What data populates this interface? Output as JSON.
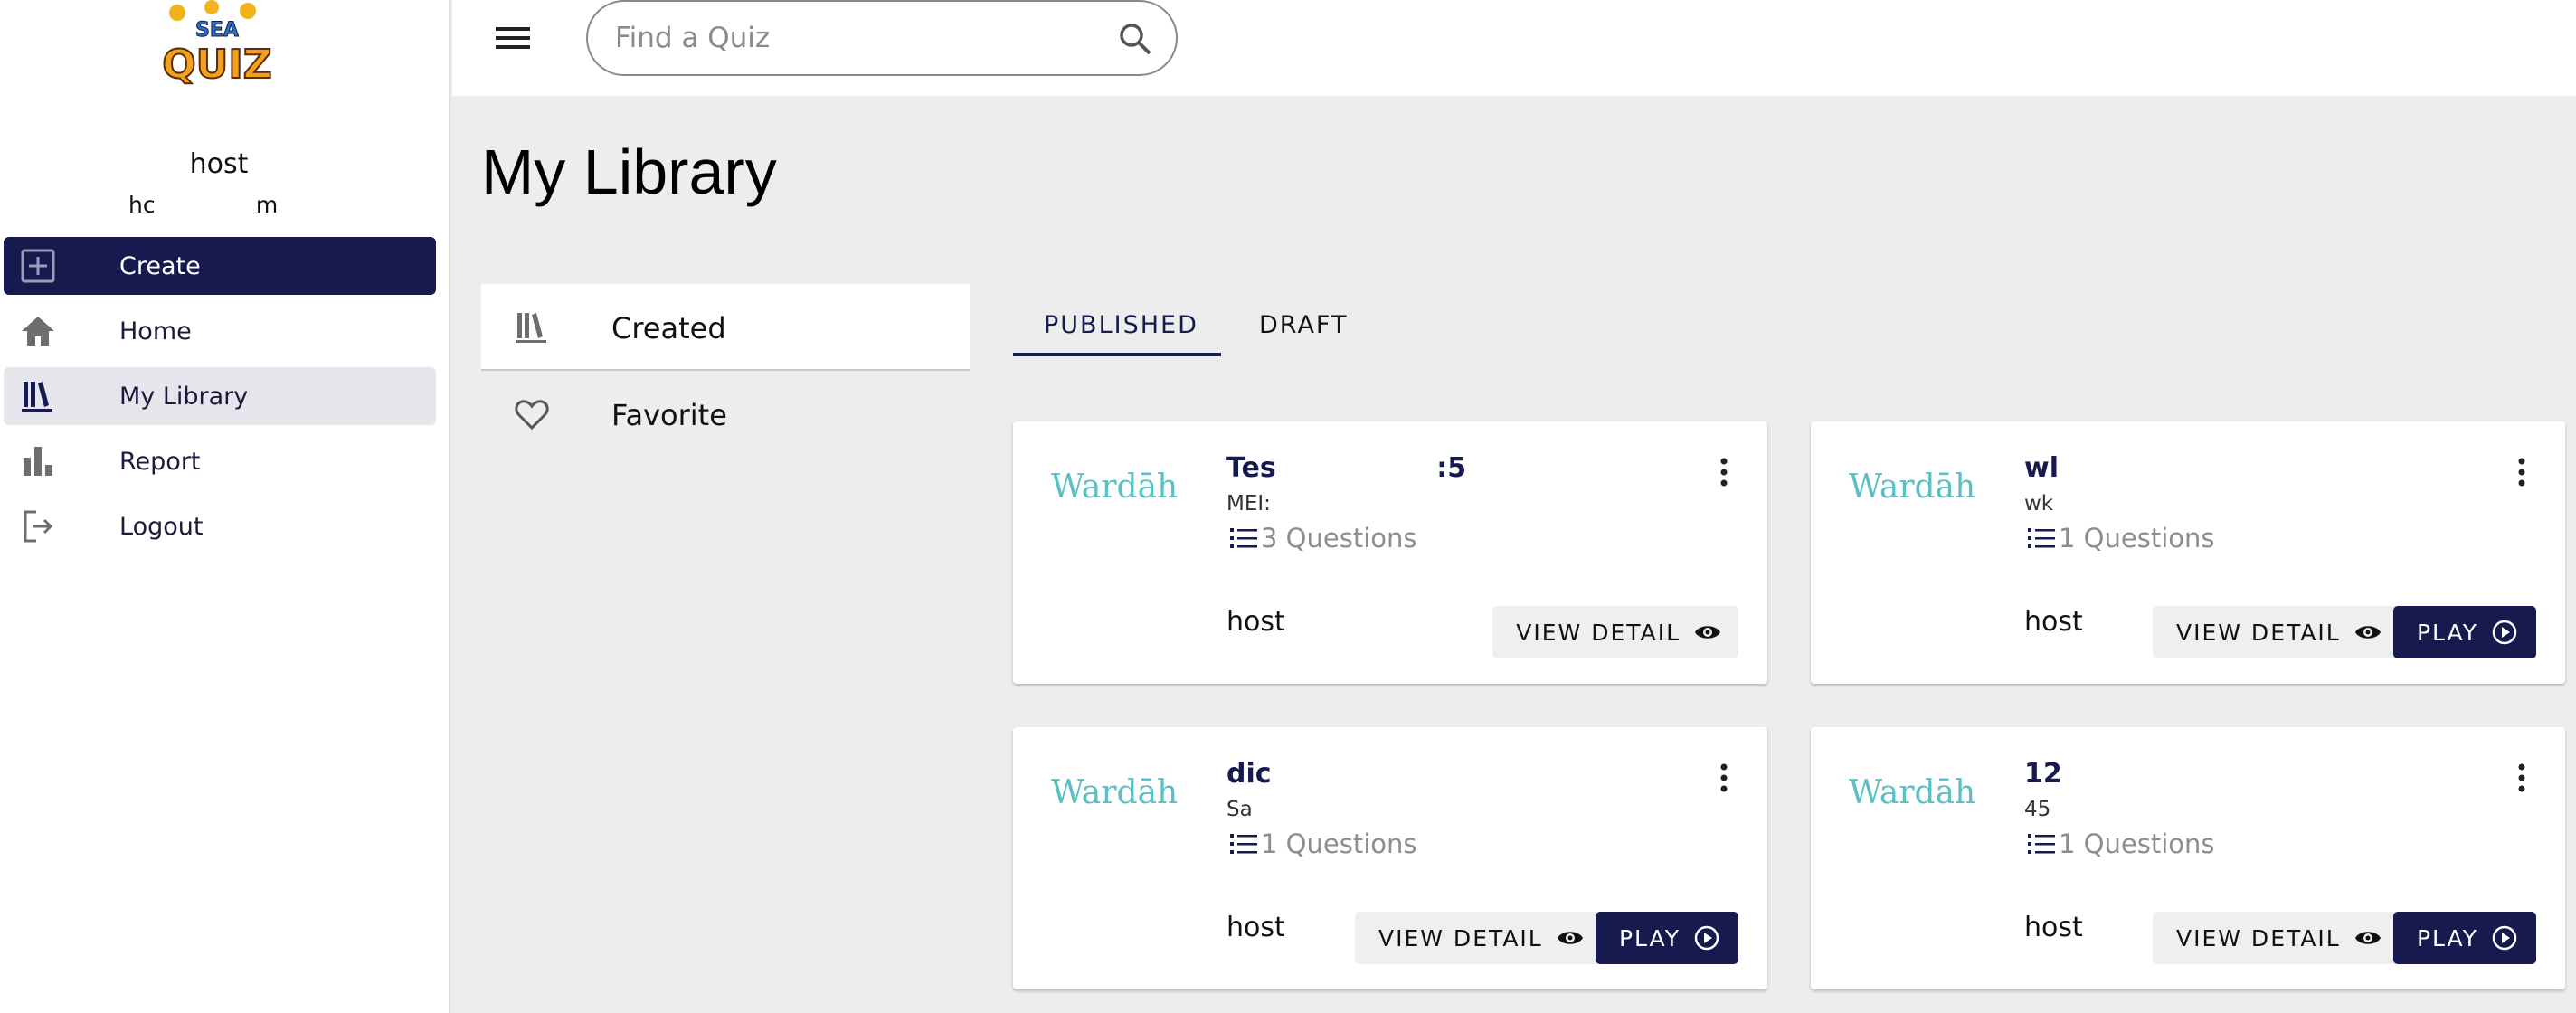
{
  "app": {
    "logo_text": "SEA QUIZ"
  },
  "sidebar": {
    "user_name": "host",
    "user_email": "hc              m",
    "items": [
      {
        "label": "Create",
        "icon": "add-box-icon"
      },
      {
        "label": "Home",
        "icon": "home-icon"
      },
      {
        "label": "My Library",
        "icon": "library-icon"
      },
      {
        "label": "Report",
        "icon": "bar-chart-icon"
      },
      {
        "label": "Logout",
        "icon": "logout-icon"
      }
    ]
  },
  "search": {
    "placeholder": "Find a Quiz",
    "value": ""
  },
  "page": {
    "title": "My Library"
  },
  "filters": [
    {
      "label": "Created",
      "icon": "library-icon"
    },
    {
      "label": "Favorite",
      "icon": "heart-icon"
    }
  ],
  "tabs": [
    {
      "label": "PUBLISHED"
    },
    {
      "label": "DRAFT"
    }
  ],
  "cards": [
    {
      "brand": "Wardāh",
      "title": "Tes                 :5",
      "subtitle": "MEI:",
      "questions": "3 Questions",
      "author": "host",
      "view_label": "VIEW DETAIL",
      "play_label": ""
    },
    {
      "brand": "Wardāh",
      "title": "wl",
      "subtitle": "wk",
      "questions": "1 Questions",
      "author": "host",
      "view_label": "VIEW DETAIL",
      "play_label": "PLAY"
    },
    {
      "brand": "Wardāh",
      "title": "dic",
      "subtitle": "Sa",
      "questions": "1 Questions",
      "author": "host",
      "view_label": "VIEW DETAIL",
      "play_label": "PLAY"
    },
    {
      "brand": "Wardāh",
      "title": "12",
      "subtitle": "45",
      "questions": "1 Questions",
      "author": "host",
      "view_label": "VIEW DETAIL",
      "play_label": "PLAY"
    }
  ],
  "colors": {
    "primary": "#161a4f",
    "brand": "#5bbfc3",
    "background": "#ededed"
  }
}
